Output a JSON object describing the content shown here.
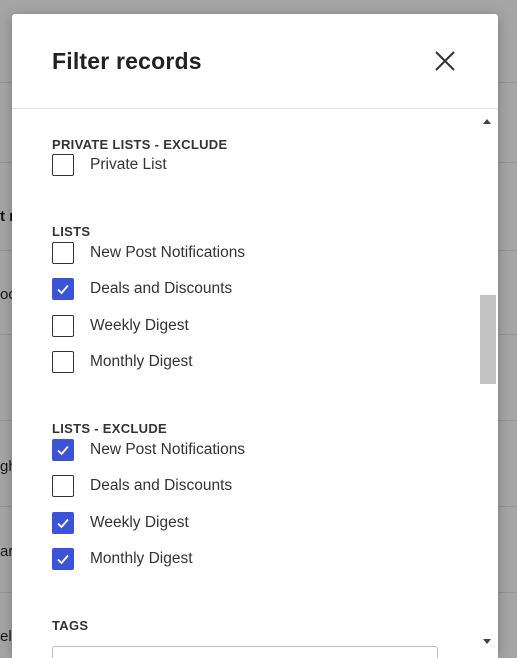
{
  "background": {
    "fragments": [
      "t n",
      "oc",
      "gh",
      "ar",
      "el Glenn"
    ]
  },
  "modal": {
    "title": "Filter records",
    "close_icon": "close-icon",
    "sections": {
      "private_exclude": {
        "label": "PRIVATE LISTS - EXCLUDE",
        "items": [
          {
            "label": "Private List",
            "checked": false
          }
        ]
      },
      "lists": {
        "label": "LISTS",
        "items": [
          {
            "label": "New Post Notifications",
            "checked": false
          },
          {
            "label": "Deals and Discounts",
            "checked": true
          },
          {
            "label": "Weekly Digest",
            "checked": false
          },
          {
            "label": "Monthly Digest",
            "checked": false
          }
        ]
      },
      "lists_exclude": {
        "label": "LISTS - EXCLUDE",
        "items": [
          {
            "label": "New Post Notifications",
            "checked": true
          },
          {
            "label": "Deals and Discounts",
            "checked": false
          },
          {
            "label": "Weekly Digest",
            "checked": true
          },
          {
            "label": "Monthly Digest",
            "checked": true
          }
        ]
      },
      "tags": {
        "label": "TAGS",
        "placeholder": ""
      }
    }
  },
  "colors": {
    "accent": "#3b54d6",
    "overlay": "rgba(0,0,0,0.32)"
  }
}
